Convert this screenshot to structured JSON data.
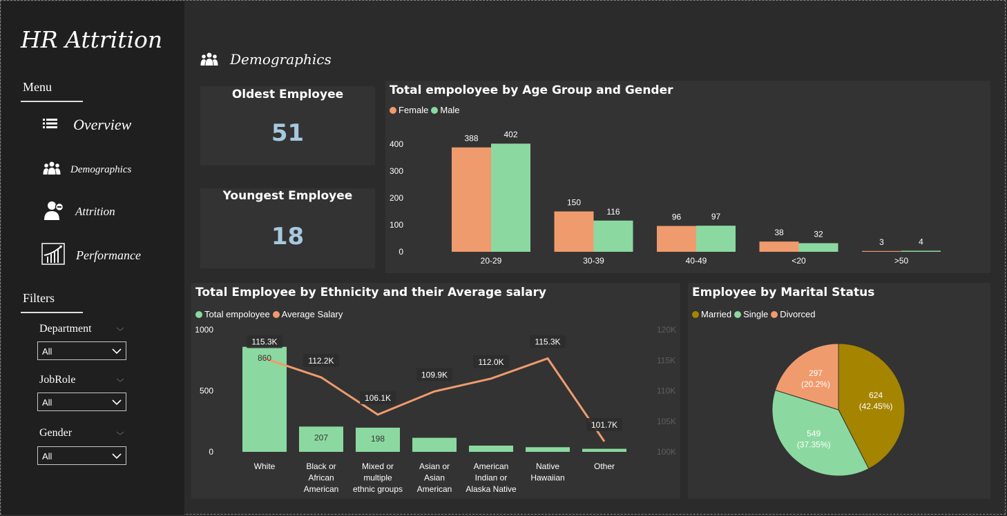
{
  "app": {
    "title": "HR Attrition"
  },
  "sidebar": {
    "menu_title": "Menu",
    "items": [
      {
        "label": "Overview",
        "icon": "list-icon"
      },
      {
        "label": "Demographics",
        "icon": "people-group-icon"
      },
      {
        "label": "Attrition",
        "icon": "user-minus-icon"
      },
      {
        "label": "Performance",
        "icon": "growth-chart-icon"
      }
    ],
    "filters_title": "Filters",
    "filters": [
      {
        "label": "Department",
        "value": "All"
      },
      {
        "label": "JobRole",
        "value": "All"
      },
      {
        "label": "Gender",
        "value": "All"
      }
    ]
  },
  "page": {
    "title": "Demographics",
    "icon": "people-group-icon"
  },
  "kpis": [
    {
      "label": "Oldest Employee",
      "value": "51"
    },
    {
      "label": "Youngest Employee",
      "value": "18"
    }
  ],
  "colors": {
    "female": "#f09b6d",
    "male": "#8bd9a0",
    "total": "#8bd9a0",
    "salary": "#f09b6d",
    "married": "#a58400",
    "single": "#8bd9a0",
    "divorced": "#f09b6d",
    "kpi_value": "#a7c9df"
  },
  "chart_data": [
    {
      "type": "bar",
      "title": "Total empoloyee by Age Group and Gender",
      "categories": [
        "20-29",
        "30-39",
        "40-49",
        "<20",
        ">50"
      ],
      "series": [
        {
          "name": "Female",
          "values": [
            388,
            150,
            96,
            38,
            3
          ]
        },
        {
          "name": "Male",
          "values": [
            402,
            116,
            97,
            32,
            4
          ]
        }
      ],
      "y_ticks": [
        "0",
        "100",
        "200",
        "300",
        "400"
      ],
      "ylim": [
        0,
        400
      ],
      "legend": "top-left"
    },
    {
      "type": "bar",
      "title": "Total Employee by Ethnicity and their Average salary",
      "categories": [
        "White",
        "Black or African American",
        "Mixed or multiple ethnic groups",
        "Asian or Asian American",
        "American Indian or Alaska Native",
        "Native Hawaiian",
        "Other"
      ],
      "category_lines": [
        [
          "White"
        ],
        [
          "Black or",
          "African",
          "American"
        ],
        [
          "Mixed or",
          "multiple",
          "ethnic groups"
        ],
        [
          "Asian or",
          "Asian",
          "American"
        ],
        [
          "American",
          "Indian or",
          "Alaska Native"
        ],
        [
          "Native",
          "Hawaiian"
        ],
        [
          "Other"
        ]
      ],
      "series": [
        {
          "name": "Total empoloyee",
          "type": "bar",
          "values": [
            860,
            207,
            198,
            115,
            51,
            38,
            25
          ],
          "labels": [
            "860",
            "207",
            "198",
            "",
            "",
            "",
            ""
          ]
        },
        {
          "name": "Average Salary",
          "type": "line",
          "values": [
            115300,
            112200,
            106100,
            109900,
            112000,
            115300,
            101700
          ],
          "labels": [
            "115.3K",
            "112.2K",
            "106.1K",
            "109.9K",
            "112.0K",
            "115.3K",
            "101.7K"
          ]
        }
      ],
      "y_ticks": [
        "0",
        "500",
        "1000"
      ],
      "ylim": [
        0,
        1000
      ],
      "y2_ticks": [
        "100K",
        "105K",
        "110K",
        "115K",
        "120K"
      ],
      "y2lim": [
        100000,
        120000
      ],
      "legend": "top-left"
    },
    {
      "type": "pie",
      "title": "Employee by Marital Status",
      "categories": [
        "Married",
        "Single",
        "Divorced"
      ],
      "values": [
        624,
        549,
        297
      ],
      "labels": [
        [
          "624",
          "(42.45%)"
        ],
        [
          "549",
          "(37.35%)"
        ],
        [
          "297",
          "(20.2%)"
        ]
      ],
      "legend": "top-left"
    }
  ]
}
